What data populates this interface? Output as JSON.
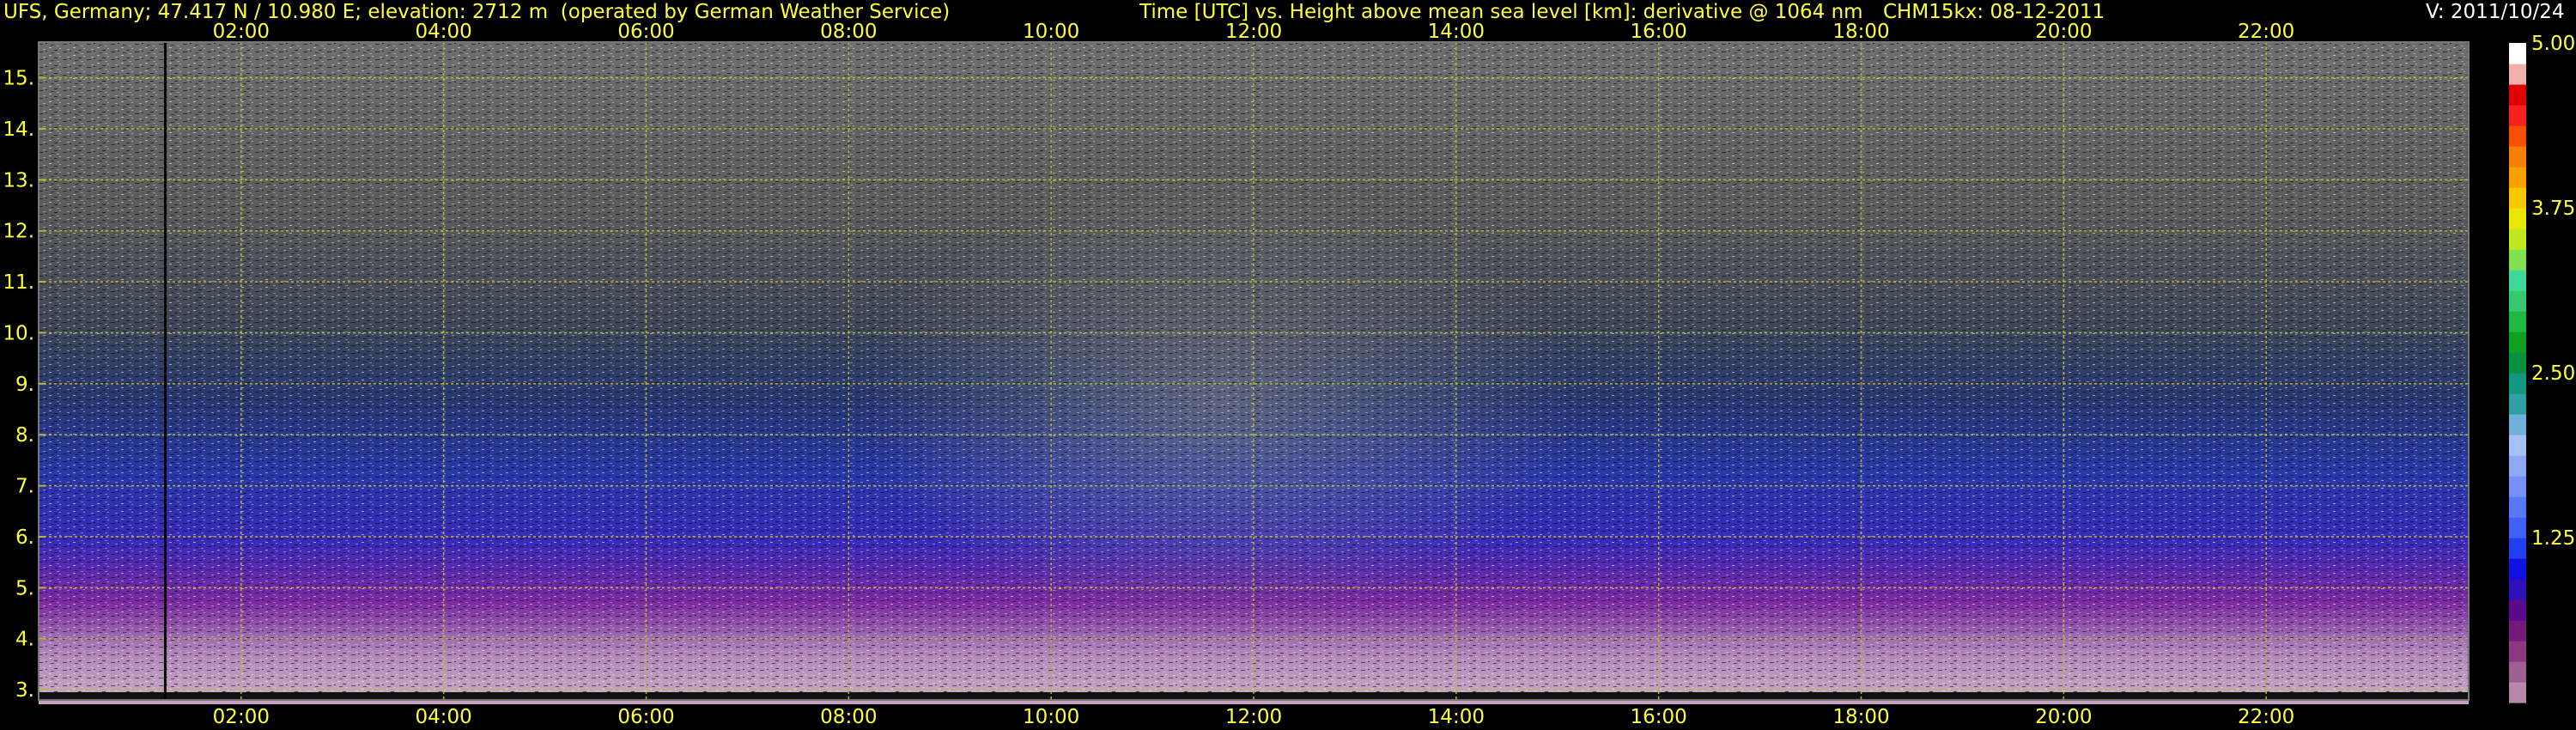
{
  "header": {
    "station": "UFS, Germany; 47.417 N / 10.980 E; elevation: 2712 m  (operated by German Weather Service)",
    "axes_desc": "Time [UTC] vs. Height above mean sea level [km]: derivative @ 1064 nm",
    "instrument": "CHM15kx: 08-12-2011",
    "version": "V: 2011/10/24"
  },
  "chart_data": {
    "type": "heatmap",
    "x_unit": "hours UTC",
    "xlim": [
      0,
      24
    ],
    "x_ticks": [
      2,
      4,
      6,
      8,
      10,
      12,
      14,
      16,
      18,
      20,
      22
    ],
    "x_tick_labels": [
      "02:00",
      "04:00",
      "06:00",
      "08:00",
      "10:00",
      "12:00",
      "14:00",
      "16:00",
      "18:00",
      "20:00",
      "22:00"
    ],
    "ylim": [
      2.8,
      15.7
    ],
    "y_ticks": [
      3,
      4,
      5,
      6,
      7,
      8,
      9,
      10,
      11,
      12,
      13,
      14,
      15
    ],
    "y_tick_labels": [
      "3.",
      "4.",
      "5.",
      "6.",
      "7.",
      "8.",
      "9.",
      "10.",
      "11.",
      "12.",
      "13.",
      "14.",
      "15."
    ],
    "grid": true,
    "marker_line_x": 1.25,
    "colorbar": {
      "range": [
        0,
        5
      ],
      "tick_values": [
        1.25,
        2.5,
        3.75,
        5.0
      ],
      "tick_labels": [
        "1.25",
        "2.50",
        "3.75",
        "5.00"
      ],
      "colors": [
        "#b58aa8",
        "#9e6090",
        "#8a3880",
        "#741a78",
        "#5a0a8a",
        "#3010b8",
        "#1010e0",
        "#2040f0",
        "#4060f8",
        "#5a78f8",
        "#7890f8",
        "#90a8f8",
        "#a8c0f8",
        "#70b0d8",
        "#30a0a0",
        "#109880",
        "#089040",
        "#10a020",
        "#20b840",
        "#38c870",
        "#40d898",
        "#80e050",
        "#c0e820",
        "#e8e800",
        "#f8c800",
        "#f8a000",
        "#f88000",
        "#f85000",
        "#f82020",
        "#e00000",
        "#f0b0b0",
        "#ffffff"
      ]
    },
    "colors": {
      "background": "#000000",
      "grid": "#b8b830",
      "label": "#ffff3a"
    }
  }
}
